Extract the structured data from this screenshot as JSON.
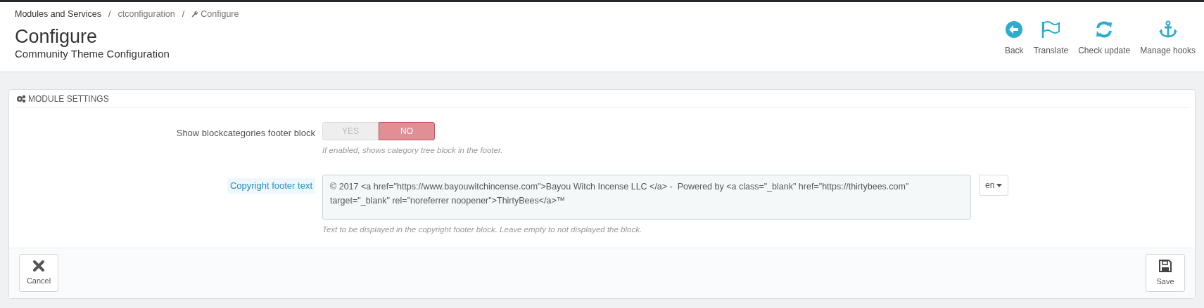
{
  "breadcrumb": [
    {
      "label": "Modules and Services",
      "kind": "link"
    },
    {
      "label": "ctconfiguration",
      "kind": "link"
    },
    {
      "label": "Configure",
      "kind": "current"
    }
  ],
  "breadcrumb_separator": "/",
  "page_title": "Configure",
  "subtitle": "Community Theme Configuration",
  "toolbar": [
    {
      "label": "Back",
      "kind": "back"
    },
    {
      "label": "Translate",
      "kind": "flag"
    },
    {
      "label": "Check update",
      "kind": "refresh"
    },
    {
      "label": "Manage hooks",
      "kind": "anchor"
    }
  ],
  "panel": {
    "title": "MODULE SETTINGS",
    "fields": [
      {
        "kind": "switch",
        "label": "Show blockcategories footer block",
        "options": [
          {
            "label": "YES",
            "selected": false
          },
          {
            "label": "NO",
            "selected": true
          }
        ],
        "help": "If enabled, shows category tree block in the footer."
      },
      {
        "kind": "textarea",
        "label": "Copyright footer text",
        "value": "© 2017 <a href=\"https://www.bayouwitchincense.com\">Bayou Witch Incense LLC </a> -  Powered by <a class=\"_blank\" href=\"https://thirtybees.com\" target=\"_blank\" rel=\"noreferrer noopener\">ThirtyBees</a>™",
        "language": "en",
        "help": "Text to be displayed in the copyright footer block. Leave empty to not displayed the block."
      }
    ]
  },
  "footer_buttons": [
    {
      "label": "Cancel",
      "kind": "cancel"
    },
    {
      "label": "Save",
      "kind": "save"
    }
  ]
}
